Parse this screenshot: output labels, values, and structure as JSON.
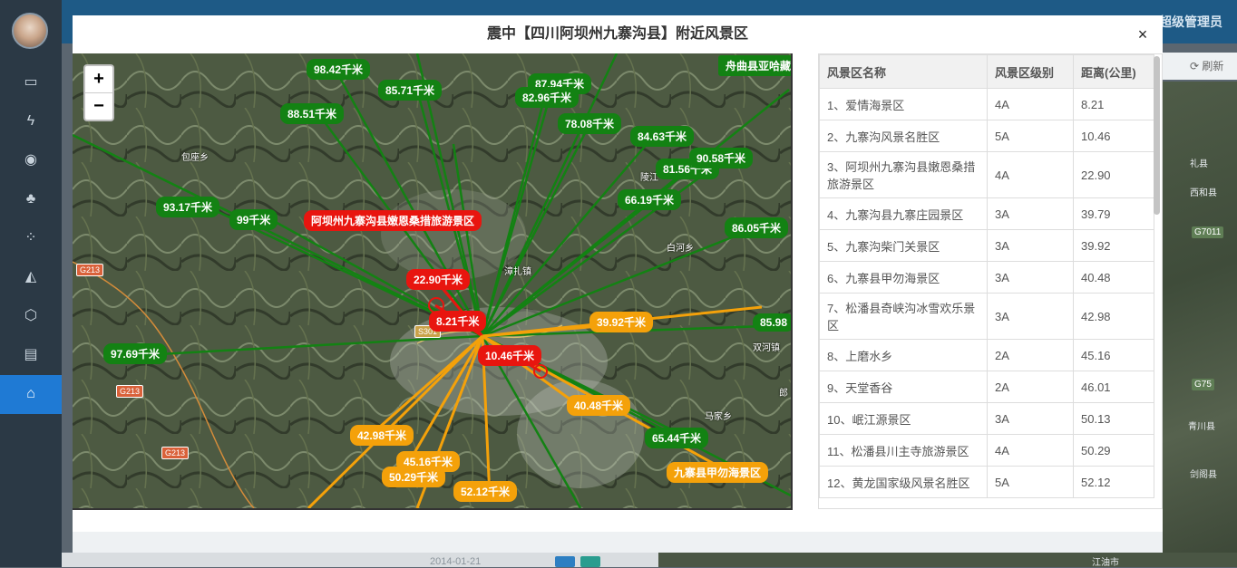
{
  "app": {
    "user_name": "超级管理员",
    "refresh_label": "刷新",
    "date_text": "2014-01-21",
    "sidebar_icons": [
      "money-icon",
      "bolt-icon",
      "target-icon",
      "tree-icon",
      "grid-icon",
      "chart-icon",
      "box-icon",
      "id-card-icon",
      "bank-icon"
    ]
  },
  "modal": {
    "title": "震中【四川阿坝州九寨沟县】附近风景区",
    "close": "×"
  },
  "map": {
    "zoom_in": "+",
    "zoom_out": "−",
    "places": [
      "包座乡",
      "漳扎镇",
      "白河乡",
      "双河镇",
      "马家乡",
      "陵江",
      "郎",
      "舟曲县亚哈藏",
      "G213",
      "G213",
      "G213",
      "S301",
      "礼县",
      "西和县",
      "青川县",
      "剑阁县",
      "江油市",
      "G7011",
      "G75"
    ],
    "red_labels": [
      "阿坝州九寨沟县嫩恩桑措旅游景区",
      "22.90千米",
      "8.21千米",
      "10.46千米"
    ],
    "green_labels": [
      "98.42千米",
      "87.94千米",
      "85.71千米",
      "82.96千米",
      "88.51千米",
      "78.08千米",
      "84.63千米",
      "81.56千米",
      "90.58千米",
      "93.17千米",
      "99千米",
      "66.19千米",
      "86.05千米",
      "85.98",
      "97.69千米",
      "65.44千米"
    ],
    "orange_labels": [
      "39.92千米",
      "40.48千米",
      "42.98千米",
      "45.16千米",
      "50.29千米",
      "52.12千米",
      "九寨县甲勿海景区"
    ]
  },
  "table": {
    "headers": [
      "风景区名称",
      "风景区级别",
      "距离(公里)"
    ],
    "rows": [
      [
        "1、爱情海景区",
        "4A",
        "8.21"
      ],
      [
        "2、九寨沟风景名胜区",
        "5A",
        "10.46"
      ],
      [
        "3、阿坝州九寨沟县嫩恩桑措旅游景区",
        "4A",
        "22.90"
      ],
      [
        "4、九寨沟县九寨庄园景区",
        "3A",
        "39.79"
      ],
      [
        "5、九寨沟柴门关景区",
        "3A",
        "39.92"
      ],
      [
        "6、九寨县甲勿海景区",
        "3A",
        "40.48"
      ],
      [
        "7、松潘县奇峡沟冰雪欢乐景区",
        "3A",
        "42.98"
      ],
      [
        "8、上磨水乡",
        "2A",
        "45.16"
      ],
      [
        "9、天堂香谷",
        "2A",
        "46.01"
      ],
      [
        "10、岷江源景区",
        "3A",
        "50.13"
      ],
      [
        "11、松潘县川主寺旅游景区",
        "4A",
        "50.29"
      ],
      [
        "12、黄龙国家级风景名胜区",
        "5A",
        "52.12"
      ]
    ]
  },
  "colors": {
    "near": "#e8150f",
    "mid": "#f4a10a",
    "far": "#138213"
  }
}
